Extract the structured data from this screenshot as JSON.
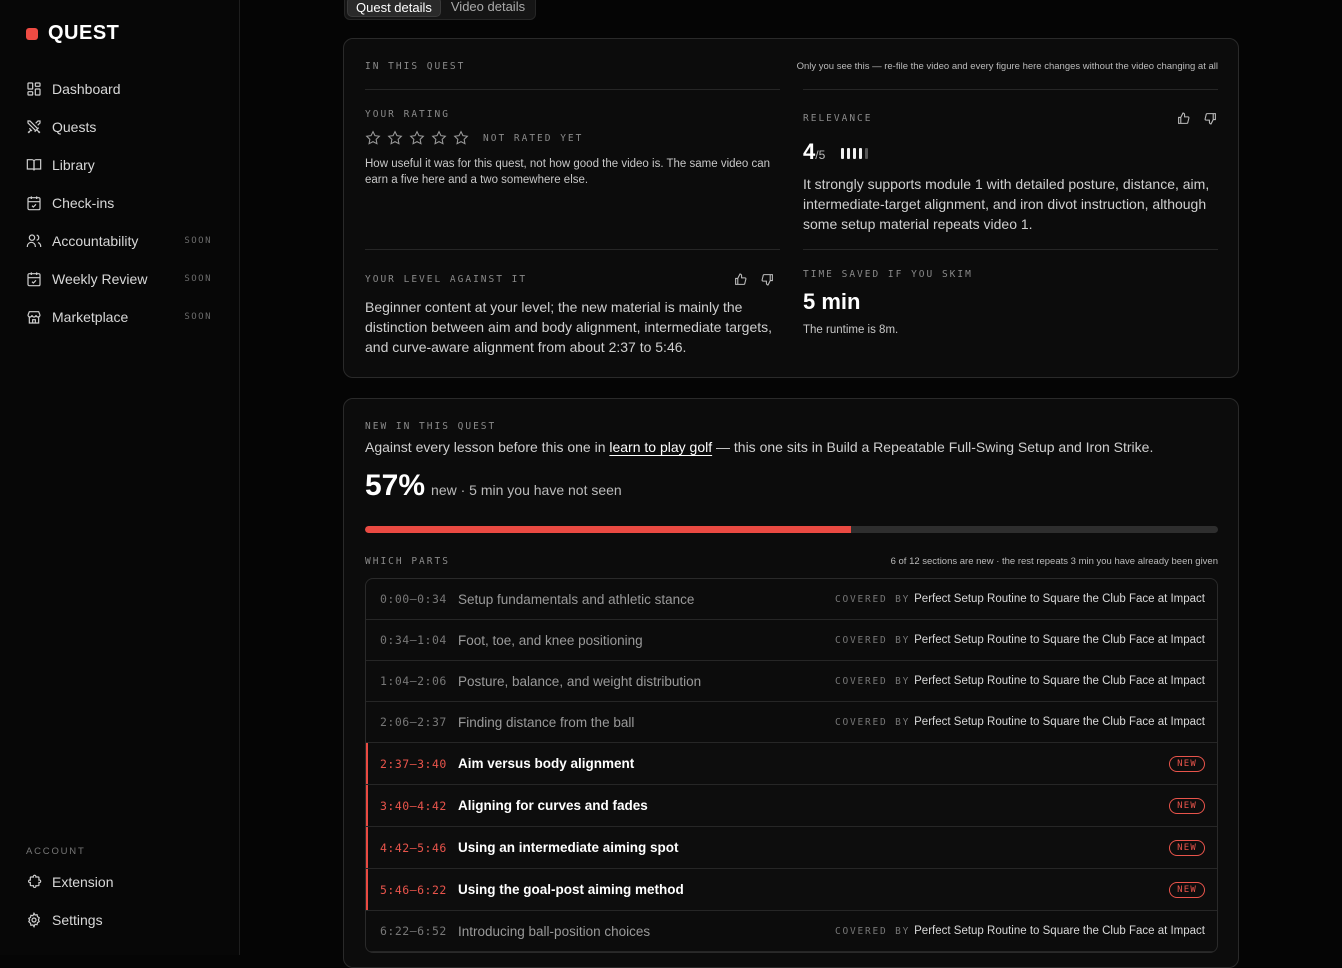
{
  "brand": {
    "name": "QUEST",
    "accent": "#ee4b43"
  },
  "nav": [
    {
      "label": "Dashboard",
      "icon": "dashboard-icon",
      "soon": ""
    },
    {
      "label": "Quests",
      "icon": "swords-icon",
      "soon": ""
    },
    {
      "label": "Library",
      "icon": "book-icon",
      "soon": ""
    },
    {
      "label": "Check-ins",
      "icon": "calendar-check-icon",
      "soon": ""
    },
    {
      "label": "Accountability",
      "icon": "users-icon",
      "soon": "SOON"
    },
    {
      "label": "Weekly Review",
      "icon": "calendar-check-icon",
      "soon": "SOON"
    },
    {
      "label": "Marketplace",
      "icon": "store-icon",
      "soon": "SOON"
    }
  ],
  "account": {
    "label": "ACCOUNT",
    "items": [
      {
        "label": "Extension",
        "icon": "puzzle-icon"
      },
      {
        "label": "Settings",
        "icon": "gear-icon"
      }
    ]
  },
  "tabs": [
    {
      "label": "Quest details",
      "active": true
    },
    {
      "label": "Video details",
      "active": false
    }
  ],
  "in_quest": {
    "label": "IN THIS QUEST",
    "note": "Only you see this — re-file the video and every figure here changes without the video changing at all",
    "rating": {
      "label": "YOUR RATING",
      "stars": 5,
      "status": "NOT RATED YET",
      "text": "How useful it was for this quest, not how good the video is. The same video can earn a five here and a two somewhere else."
    },
    "relevance": {
      "label": "RELEVANCE",
      "score": "4",
      "out_of": "/5",
      "value": 4,
      "max": 5,
      "text": "It strongly supports module 1 with detailed posture, distance, aim, intermediate-target alignment, and iron divot instruction, although some setup material repeats video 1."
    },
    "level": {
      "label": "YOUR LEVEL AGAINST IT",
      "text": "Beginner content at your level; the new material is mainly the distinction between aim and body alignment, intermediate targets, and curve-aware alignment from about 2:37 to 5:46."
    },
    "time_saved": {
      "label": "TIME SAVED IF YOU SKIM",
      "value": "5 min",
      "text": "The runtime is 8m."
    }
  },
  "new_in_quest": {
    "label": "NEW IN THIS QUEST",
    "sentence_pre": "Against every lesson before this one in ",
    "link": "learn to play golf",
    "sentence_post": " — this one sits in Build a Repeatable Full-Swing Setup and Iron Strike.",
    "percent": "57%",
    "percent_value": 57,
    "percent_sub": "new · 5 min you have not seen",
    "which_parts_label": "WHICH PARTS",
    "which_parts_note": "6 of 12 sections are new · the rest repeats 3 min you have already been given",
    "covered_label": "COVERED BY",
    "new_label": "NEW",
    "sections": [
      {
        "time": "0:00–0:34",
        "title": "Setup fundamentals and athletic stance",
        "new": false,
        "covered_by": "Perfect Setup Routine to Square the Club Face at Impact"
      },
      {
        "time": "0:34–1:04",
        "title": "Foot, toe, and knee positioning",
        "new": false,
        "covered_by": "Perfect Setup Routine to Square the Club Face at Impact"
      },
      {
        "time": "1:04–2:06",
        "title": "Posture, balance, and weight distribution",
        "new": false,
        "covered_by": "Perfect Setup Routine to Square the Club Face at Impact"
      },
      {
        "time": "2:06–2:37",
        "title": "Finding distance from the ball",
        "new": false,
        "covered_by": "Perfect Setup Routine to Square the Club Face at Impact"
      },
      {
        "time": "2:37–3:40",
        "title": "Aim versus body alignment",
        "new": true,
        "covered_by": ""
      },
      {
        "time": "3:40–4:42",
        "title": "Aligning for curves and fades",
        "new": true,
        "covered_by": ""
      },
      {
        "time": "4:42–5:46",
        "title": "Using an intermediate aiming spot",
        "new": true,
        "covered_by": ""
      },
      {
        "time": "5:46–6:22",
        "title": "Using the goal-post aiming method",
        "new": true,
        "covered_by": ""
      },
      {
        "time": "6:22–6:52",
        "title": "Introducing ball-position choices",
        "new": false,
        "covered_by": "Perfect Setup Routine to Square the Club Face at Impact"
      }
    ]
  }
}
